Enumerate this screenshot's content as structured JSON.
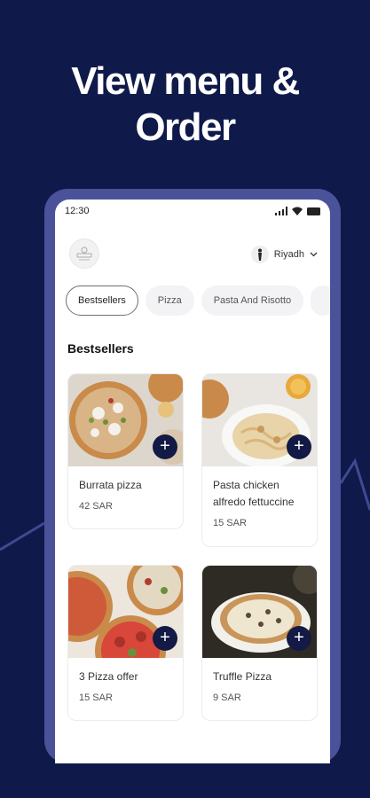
{
  "promo": {
    "headline_line1": "View menu &",
    "headline_line2": "Order"
  },
  "colors": {
    "background": "#0f1a4a",
    "phone_frame": "#4a5299",
    "accent": "#121a45"
  },
  "status_bar": {
    "time": "12:30"
  },
  "header": {
    "logo_icon": "restaurant-logo-icon",
    "location": "Riyadh"
  },
  "categories": [
    {
      "label": "Bestsellers",
      "active": true
    },
    {
      "label": "Pizza",
      "active": false
    },
    {
      "label": "Pasta And Risotto",
      "active": false
    }
  ],
  "section": {
    "title": "Bestsellers"
  },
  "products": [
    {
      "name": "Burrata pizza",
      "price": "42 SAR"
    },
    {
      "name": "Pasta chicken alfredo fettuccine",
      "price": "15 SAR"
    },
    {
      "name": "3 Pizza offer",
      "price": "15 SAR"
    },
    {
      "name": "Truffle Pizza",
      "price": "9 SAR"
    }
  ],
  "add_label": "+"
}
